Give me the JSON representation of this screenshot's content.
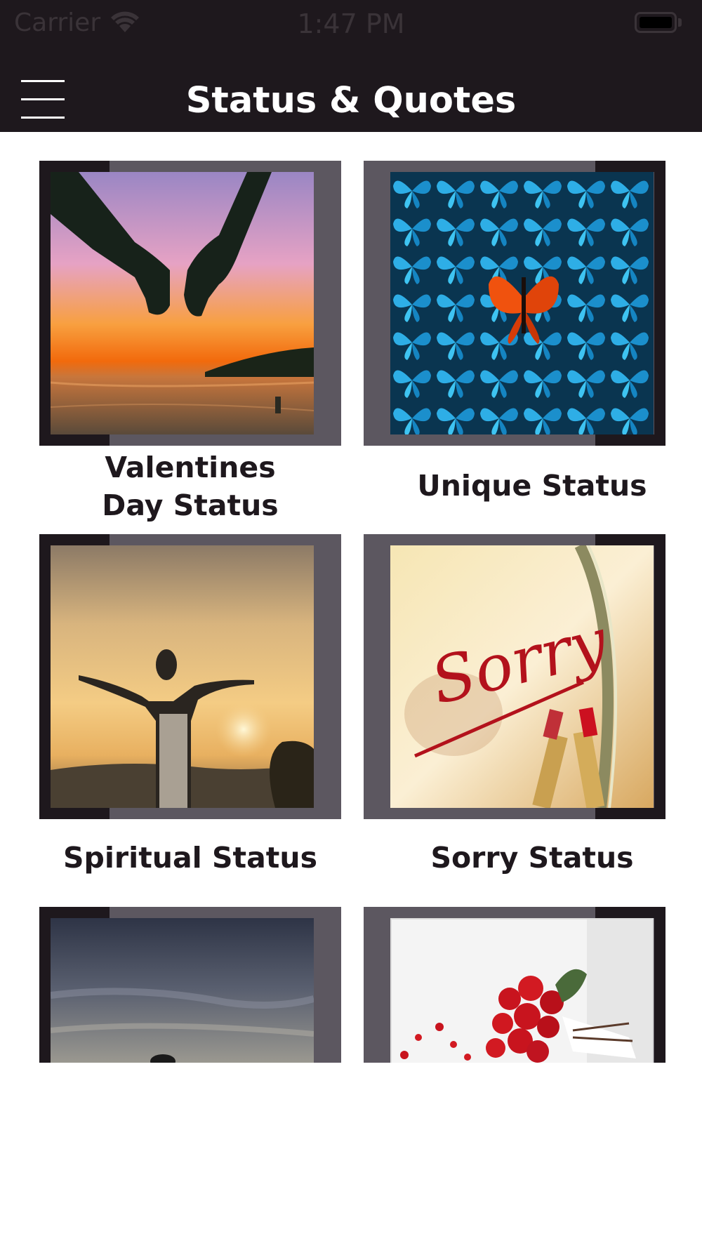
{
  "status_bar": {
    "carrier": "Carrier",
    "time": "1:47 PM"
  },
  "nav": {
    "title": "Status & Quotes",
    "menu_icon": "hamburger-menu-icon"
  },
  "categories": [
    {
      "label_line1": "Valentines",
      "label_line2": "Day Status",
      "image": "holding-hands-sunset"
    },
    {
      "label_line1": "Unique Status",
      "label_line2": "",
      "image": "blue-butterflies-one-orange"
    },
    {
      "label_line1": "Spiritual Status",
      "label_line2": "",
      "image": "arms-raised-sunset"
    },
    {
      "label_line1": "Sorry Status",
      "label_line2": "",
      "image": "sorry-lipstick-mirror"
    },
    {
      "label_line1": "",
      "label_line2": "",
      "image": "cloudy-dusk-sky"
    },
    {
      "label_line1": "",
      "label_line2": "",
      "image": "red-roses-bouquet"
    }
  ],
  "colors": {
    "bar_background": "#1e181d",
    "frame": "#5c5760",
    "label_text": "#1e181d"
  }
}
